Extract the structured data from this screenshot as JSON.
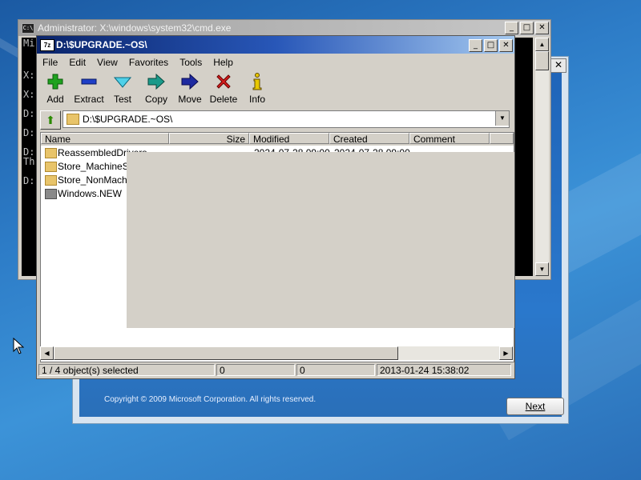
{
  "setup": {
    "copyright": "Copyright © 2009 Microsoft Corporation. All rights reserved.",
    "next_label": "Next",
    "close_glyph": "✕"
  },
  "cmd": {
    "title": "Administrator: X:\\windows\\system32\\cmd.exe",
    "icon_text": "C:\\",
    "lines": [
      "Mi",
      "X:",
      "X:",
      "D:",
      "D:",
      "D:",
      "Th",
      "D:"
    ]
  },
  "sevenzip": {
    "title": "D:\\$UPGRADE.~OS\\",
    "icon_text": "7z",
    "menu": [
      "File",
      "Edit",
      "View",
      "Favorites",
      "Tools",
      "Help"
    ],
    "toolbar": [
      {
        "label": "Add",
        "icon": "plus-icon",
        "color": "#1fa21f"
      },
      {
        "label": "Extract",
        "icon": "minus-icon",
        "color": "#1e3fc8"
      },
      {
        "label": "Test",
        "icon": "check-icon",
        "color": "#1aa6c8"
      },
      {
        "label": "Copy",
        "icon": "copy-arrow-icon",
        "color": "#1a9a8a"
      },
      {
        "label": "Move",
        "icon": "move-arrow-icon",
        "color": "#1e2aa0"
      },
      {
        "label": "Delete",
        "icon": "delete-x-icon",
        "color": "#d81e1e"
      },
      {
        "label": "Info",
        "icon": "info-icon",
        "color": "#d8b400"
      }
    ],
    "address": "D:\\$UPGRADE.~OS\\",
    "columns": [
      "Name",
      "Size",
      "Modified",
      "Created",
      "Comment"
    ],
    "files": [
      {
        "name": "ReassembledDrivers",
        "modified": "2024-07-28 09:00",
        "created": "2024-07-28 09:00",
        "folder": true
      },
      {
        "name": "Store_MachineSpe",
        "modified": "",
        "created": "",
        "folder": true
      },
      {
        "name": "Store_NonMachine",
        "modified": "",
        "created": "",
        "folder": true
      },
      {
        "name": "Windows.NEW",
        "modified": "",
        "created": "",
        "folder": false
      }
    ],
    "status": {
      "selection": "1 / 4 object(s) selected",
      "size": "0",
      "packed": "0",
      "date": "2013-01-24 15:38:02"
    }
  }
}
